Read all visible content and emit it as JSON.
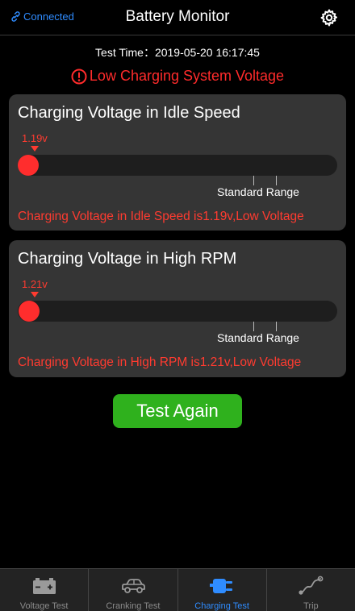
{
  "header": {
    "connection_status": "Connected",
    "title": "Battery Monitor"
  },
  "test_time": "Test Time：2019-05-20 16:17:45",
  "warning": "Low Charging System Voltage",
  "idle_card": {
    "title": "Charging Voltage in Idle Speed",
    "value_label": "1.19v",
    "standard_range_label": "Standard Range",
    "status": "Charging Voltage in Idle Speed is1.19v,Low Voltage"
  },
  "rpm_card": {
    "title": "Charging Voltage in High RPM",
    "value_label": "1.21v",
    "standard_range_label": "Standard Range",
    "status": "Charging Voltage in High RPM is1.21v,Low Voltage"
  },
  "test_again_label": "Test Again",
  "tabs": [
    {
      "label": "Voltage Test",
      "icon": "battery-icon"
    },
    {
      "label": "Cranking Test",
      "icon": "car-icon"
    },
    {
      "label": "Charging Test",
      "icon": "plug-icon",
      "active": true
    },
    {
      "label": "Trip",
      "icon": "route-icon"
    }
  ],
  "colors": {
    "accent_blue": "#2f8cff",
    "alert_red": "#ff3b30",
    "button_green": "#2fb11d"
  }
}
